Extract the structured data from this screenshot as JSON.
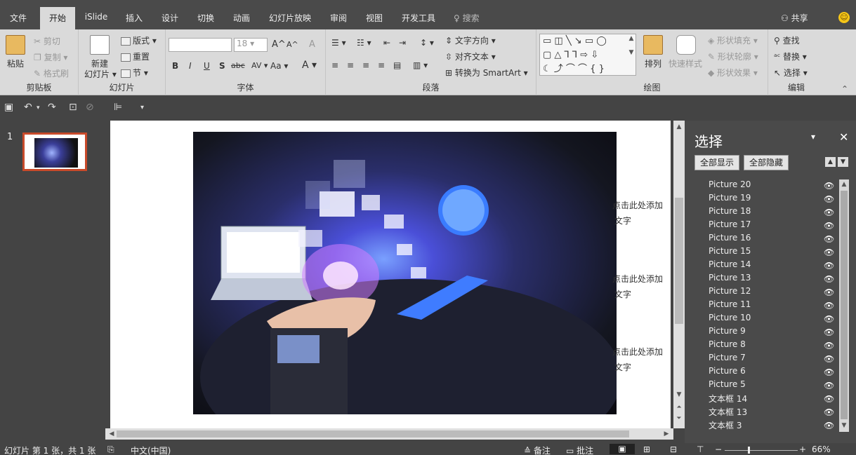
{
  "menu": {
    "tabs": [
      "文件",
      "开始",
      "iSlide",
      "插入",
      "设计",
      "切换",
      "动画",
      "幻灯片放映",
      "审阅",
      "视图",
      "开发工具"
    ],
    "search": "搜索",
    "share": "共享"
  },
  "ribbon": {
    "clipboard": {
      "paste": "粘贴",
      "cut": "剪切",
      "copy": "复制",
      "format_painter": "格式刷",
      "label": "剪贴板"
    },
    "slides": {
      "new_slide_line1": "新建",
      "new_slide_line2": "幻灯片",
      "layout": "版式",
      "reset": "重置",
      "section": "节",
      "label": "幻灯片"
    },
    "font": {
      "font_size": "18",
      "bold": "B",
      "italic": "I",
      "underline": "U",
      "shadow": "S",
      "strike": "abc",
      "spacing": "AV",
      "case": "Aa",
      "color": "A",
      "grow": "A^",
      "shrink": "A^",
      "clear": "A",
      "label": "字体"
    },
    "paragraph": {
      "text_direction": "文字方向",
      "align_text": "对齐文本",
      "smartart": "转换为 SmartArt",
      "label": "段落"
    },
    "drawing": {
      "arrange": "排列",
      "quick_styles": "快速样式",
      "shape_fill": "形状填充",
      "shape_outline": "形状轮廓",
      "shape_effects": "形状效果",
      "label": "绘图"
    },
    "editing": {
      "find": "查找",
      "replace": "替换",
      "select": "选择",
      "label": "编辑"
    }
  },
  "thumbnails": {
    "slide_number": "1"
  },
  "slide": {
    "placeholders": [
      {
        "line1": "点击此处添加",
        "line2": "文字"
      },
      {
        "line1": "点击此处添加",
        "line2": "文字"
      },
      {
        "line1": "点击此处添加",
        "line2": "文字"
      }
    ]
  },
  "selection_pane": {
    "title": "选择",
    "show_all": "全部显示",
    "hide_all": "全部隐藏",
    "items": [
      "Picture 20",
      "Picture 19",
      "Picture 18",
      "Picture 17",
      "Picture 16",
      "Picture 15",
      "Picture 14",
      "Picture 13",
      "Picture 12",
      "Picture 11",
      "Picture 10",
      "Picture 9",
      "Picture 8",
      "Picture 7",
      "Picture 6",
      "Picture 5",
      "文本框 14",
      "文本框 13",
      "文本框 3"
    ]
  },
  "status": {
    "slide_info": "幻灯片 第 1 张，共 1 张",
    "language": "中文(中国)",
    "notes": "备注",
    "comments": "批注",
    "zoom": "66%"
  },
  "colors": {
    "accent": "#c84a2a",
    "ribbon": "#dadada",
    "dark": "#444444"
  }
}
